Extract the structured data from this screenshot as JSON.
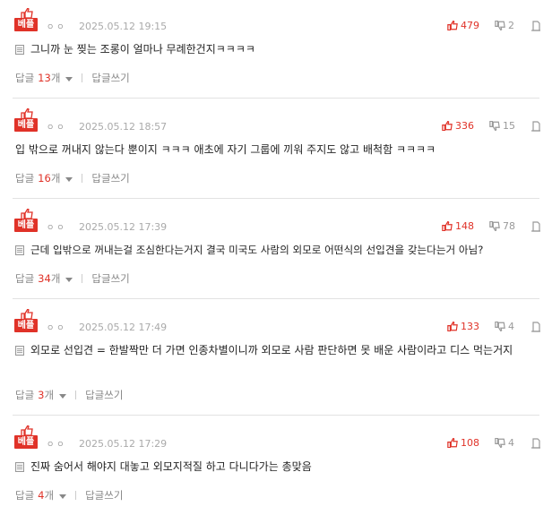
{
  "best_label": "베플",
  "dots": "ㅇㅇ",
  "reply_label": "답글",
  "reply_unit": "개",
  "write_reply_label": "답글쓰기",
  "colors": {
    "accent": "#e03228",
    "muted": "#999999"
  },
  "icons": {
    "thumb_up": "thumb-up-icon",
    "thumb_down": "thumb-down-icon",
    "more": "more-icon",
    "doc": "doc-icon"
  },
  "comments": [
    {
      "date": "2025.05.12 19:15",
      "likes": "479",
      "dislikes": "2",
      "text": "그니까 눈 찢는 조롱이 얼마나 무례한건지ㅋㅋㅋㅋ",
      "reply_count": "13"
    },
    {
      "date": "2025.05.12 18:57",
      "likes": "336",
      "dislikes": "15",
      "text": "입 밖으로 꺼내지 않는다 뿐이지 ㅋㅋㅋ 애초에 자기 그룹에 끼워 주지도 않고 배척함 ㅋㅋㅋㅋ",
      "reply_count": "16"
    },
    {
      "date": "2025.05.12 17:39",
      "likes": "148",
      "dislikes": "78",
      "text": "근데 입밖으로 꺼내는걸 조심한다는거지 결국 미국도 사람의 외모로 어떤식의 선입견을 갖는다는거 아님?",
      "reply_count": "34"
    },
    {
      "date": "2025.05.12 17:49",
      "likes": "133",
      "dislikes": "4",
      "text": "외모로 선입견 = 한발짝만 더 가면 인종차별이니까 외모로 사람 판단하면 못 배운 사람이라고 디스 먹는거지",
      "reply_count": "3"
    },
    {
      "date": "2025.05.12 17:29",
      "likes": "108",
      "dislikes": "4",
      "text": "진짜 숨어서 해야지 대놓고 외모지적질 하고 다니다가는 총맞음",
      "reply_count": "4"
    }
  ]
}
